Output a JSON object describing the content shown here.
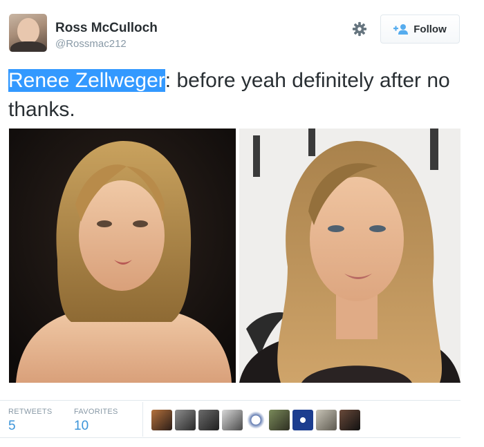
{
  "user": {
    "name": "Ross McCulloch",
    "handle": "@Rossmac212"
  },
  "follow_button": {
    "label": "Follow",
    "icon": "add-user-icon"
  },
  "settings_icon": "gear-icon",
  "tweet": {
    "highlighted_text": "Renee Zellweger",
    "text_rest": ": before yeah definitely after no thanks."
  },
  "photos": [
    {
      "name": "photo-before"
    },
    {
      "name": "photo-after"
    }
  ],
  "stats": {
    "retweets_label": "RETWEETS",
    "retweets_value": "5",
    "favorites_label": "FAVORITES",
    "favorites_value": "10"
  },
  "favorited_by_count": 9,
  "colors": {
    "highlight": "#3399ff",
    "link": "#3b94d9",
    "muted": "#8899a6",
    "text": "#292f33"
  }
}
